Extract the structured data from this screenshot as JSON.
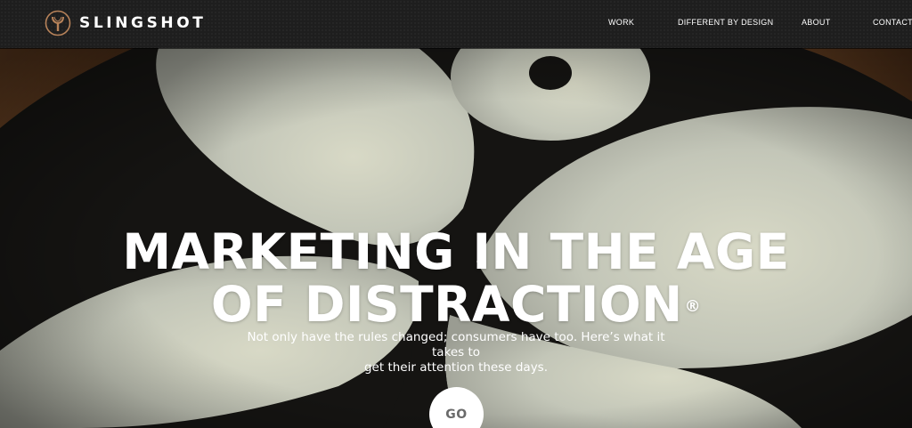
{
  "header": {
    "logo_text": "SLINGSHOT",
    "nav": [
      {
        "label": "WORK"
      },
      {
        "label": "DIFFERENT BY DESIGN"
      },
      {
        "label": "ABOUT"
      },
      {
        "label": "CONTACT"
      }
    ]
  },
  "hero": {
    "headline_line1": "MARKETING IN THE AGE",
    "headline_line2": "OF DISTRACTION",
    "registered_mark": "®",
    "subtext_line1": "Not only have the rules changed; consumers have too. Here’s what it takes to",
    "subtext_line2": "get their attention these days.",
    "go_label": "GO"
  },
  "colors": {
    "header_bg": "#1e1e1e",
    "logo_accent": "#b8835a",
    "hero_bg": "#131211",
    "shape_fill": "#c9cbbd",
    "text": "#ffffff",
    "go_text": "#6a6a6a"
  }
}
